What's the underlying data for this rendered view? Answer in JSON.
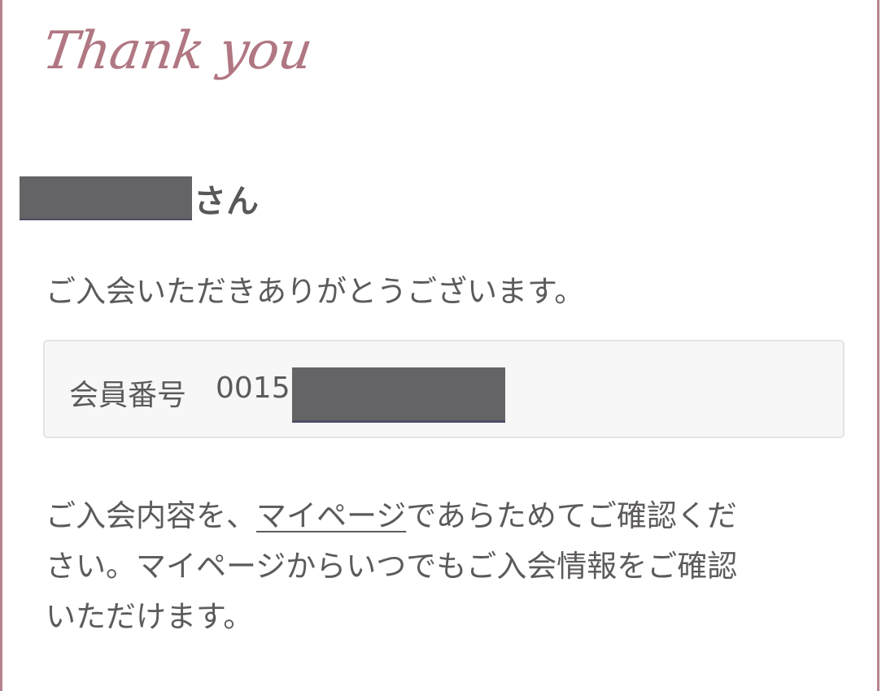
{
  "heading": {
    "thanks": "Thank you"
  },
  "greeting": {
    "suffix": "さん"
  },
  "message": {
    "welcome": "ご入会いただきありがとうございます。"
  },
  "member": {
    "label": "会員番号",
    "number_prefix": "0015"
  },
  "info": {
    "line1_before": "ご入会内容を、",
    "link_label": "マイページ",
    "line1_after": "であらためてご確認くだ",
    "line2": "さい。マイページからいつでもご入会情報をご確認",
    "line3": "いただけます。"
  },
  "colors": {
    "accent": "#b07782",
    "border": "#b5838c",
    "text": "#5d5a5b",
    "box_bg": "#f7f7f7",
    "redaction": "#646466"
  }
}
